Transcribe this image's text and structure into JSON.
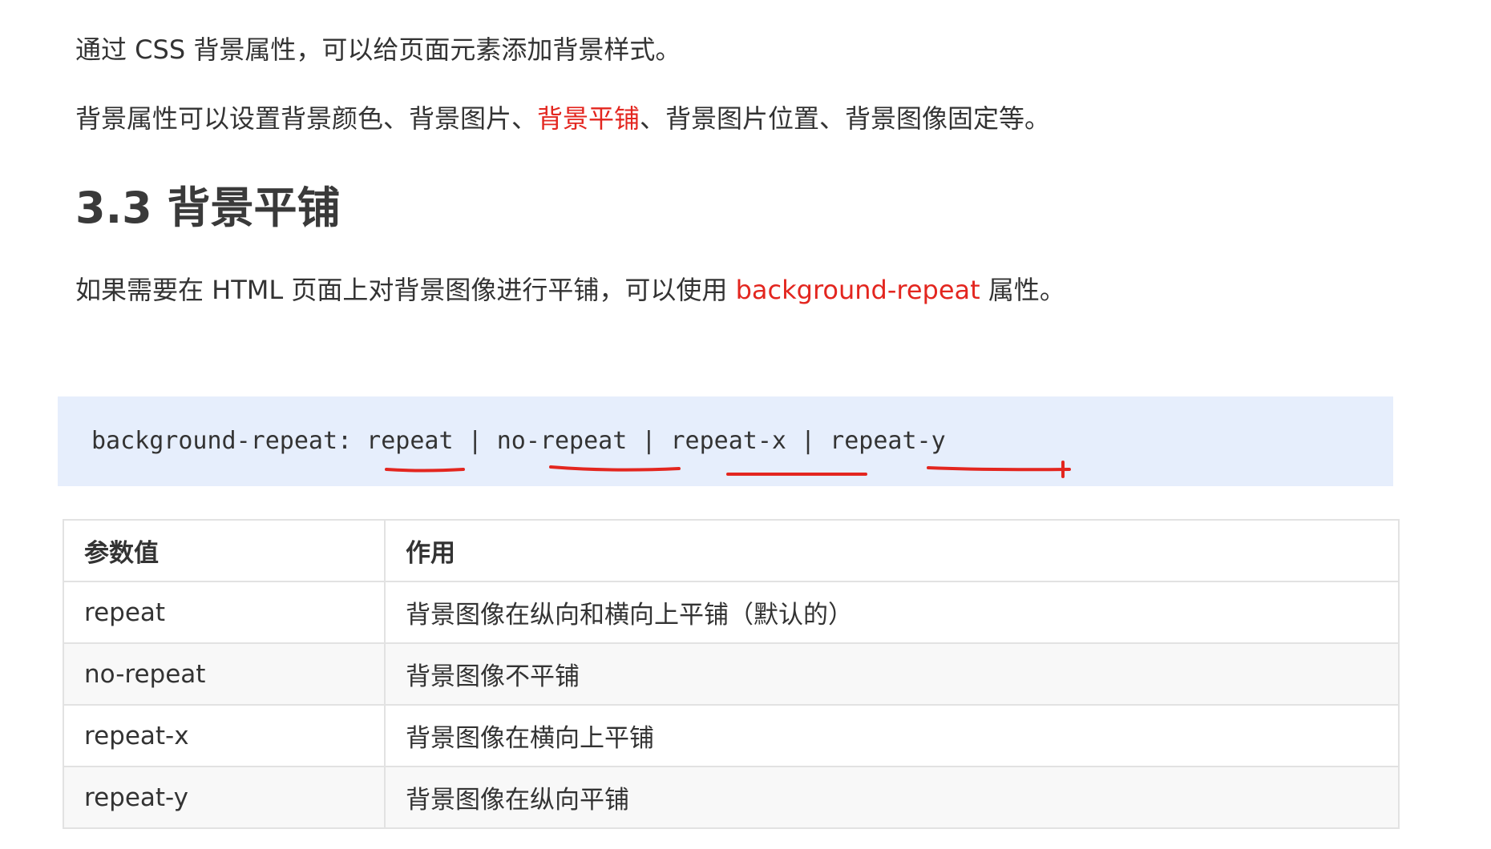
{
  "intro": {
    "line1": "通过 CSS 背景属性，可以给页面元素添加背景样式。",
    "line2_before": "背景属性可以设置背景颜色、背景图片、",
    "line2_highlight": "背景平铺",
    "line2_after": "、背景图片位置、背景图像固定等。"
  },
  "section": {
    "number": "3.3",
    "title": "背景平铺"
  },
  "description": {
    "before": "如果需要在 HTML 页面上对背景图像进行平铺，可以使用 ",
    "highlight": "background-repeat",
    "after": " 属性。"
  },
  "code": {
    "text": "background-repeat: repeat | no-repeat | repeat-x | repeat-y"
  },
  "table": {
    "headers": [
      "参数值",
      "作用"
    ],
    "rows": [
      {
        "value": "repeat",
        "effect": "背景图像在纵向和横向上平铺（默认的）"
      },
      {
        "value": "no-repeat",
        "effect": "背景图像不平铺"
      },
      {
        "value": "repeat-x",
        "effect": "背景图像在横向上平铺"
      },
      {
        "value": "repeat-y",
        "effect": "背景图像在纵向平铺"
      }
    ]
  },
  "colors": {
    "highlight": "#e3261f",
    "code_background": "#e6eefc",
    "annotation": "#e3261f"
  }
}
